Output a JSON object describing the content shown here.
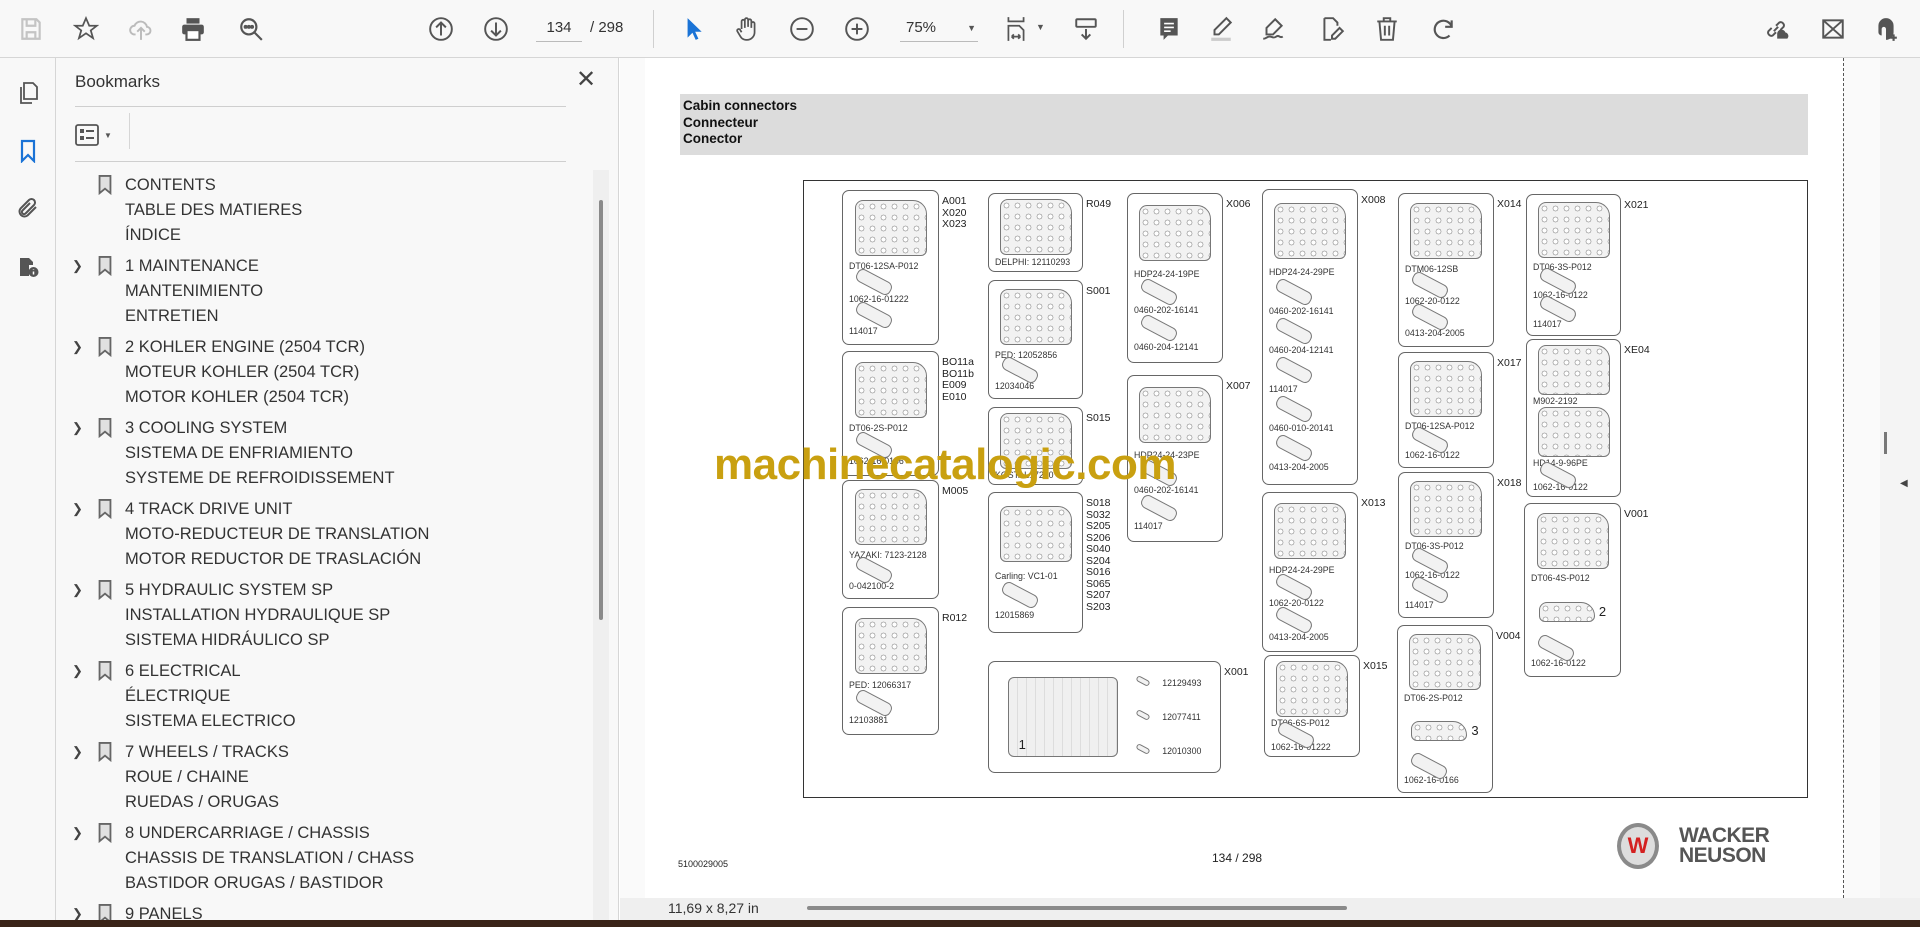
{
  "toolbar": {
    "page_current": "134",
    "page_total": "/ 298",
    "zoom": "75%",
    "accent": "#1a73d6"
  },
  "bookmarks": {
    "title": "Bookmarks",
    "close": "✕",
    "items": [
      {
        "lines": [
          "CONTENTS",
          "TABLE DES MATIERES",
          "ÍNDICE"
        ],
        "expandable": false
      },
      {
        "lines": [
          "1 MAINTENANCE",
          "MANTENIMIENTO",
          "ENTRETIEN"
        ],
        "expandable": true
      },
      {
        "lines": [
          "2 KOHLER ENGINE (2504 TCR)",
          "MOTEUR KOHLER (2504 TCR)",
          "MOTOR KOHLER (2504 TCR)"
        ],
        "expandable": true
      },
      {
        "lines": [
          "3 COOLING SYSTEM",
          "SISTEMA DE ENFRIAMIENTO",
          "SYSTEME DE REFROIDISSEMENT"
        ],
        "expandable": true
      },
      {
        "lines": [
          "4 TRACK DRIVE UNIT",
          "MOTO-REDUCTEUR DE TRANSLATION",
          "MOTOR REDUCTOR DE TRASLACIÓN"
        ],
        "expandable": true
      },
      {
        "lines": [
          "5 HYDRAULIC SYSTEM SP",
          "INSTALLATION HYDRAULIQUE SP",
          "SISTEMA HIDRÁULICO SP"
        ],
        "expandable": true
      },
      {
        "lines": [
          "6 ELECTRICAL",
          "ÉLECTRIQUE",
          "SISTEMA ELECTRICO"
        ],
        "expandable": true
      },
      {
        "lines": [
          "7 WHEELS / TRACKS",
          "ROUE / CHAINE",
          "RUEDAS / ORUGAS"
        ],
        "expandable": true
      },
      {
        "lines": [
          "8 UNDERCARRIAGE / CHASSIS",
          "CHASSIS DE TRANSLATION / CHASS",
          "BASTIDOR ORUGAS / BASTIDOR"
        ],
        "expandable": true
      },
      {
        "lines": [
          "9 PANELS"
        ],
        "expandable": true
      }
    ]
  },
  "page": {
    "header": [
      "Cabin connectors",
      "Connecteur",
      "Conector"
    ],
    "watermark": "machinecatalogic.com",
    "doc_code": "5100029005",
    "page_label": "134 / 298",
    "logo_text": [
      "WACKER",
      "NEUSON"
    ],
    "logo_mark": "W",
    "boxes": [
      {
        "ids": [
          "A001",
          "X020",
          "X023"
        ],
        "parts": [
          "DT06-12SA-P012",
          "1062-16-01222",
          "114017"
        ]
      },
      {
        "ids": [
          "BO11a",
          "BO11b",
          "E009",
          "E010"
        ],
        "parts": [
          "DT06-2S-P012",
          "1062-16-0166"
        ]
      },
      {
        "ids": [
          "M005"
        ],
        "parts": [
          "YAZAKI: 7123-2128",
          "0-042100-2"
        ]
      },
      {
        "ids": [
          "R012"
        ],
        "parts": [
          "PED: 12066317",
          "12103881"
        ]
      },
      {
        "ids": [
          "R049"
        ],
        "parts": [
          "DELPHI: 12110293"
        ]
      },
      {
        "ids": [
          "S001"
        ],
        "parts": [
          "PED: 12052856",
          "12034046"
        ]
      },
      {
        "ids": [
          "S015"
        ],
        "parts": [
          "KOSTAL: 7210"
        ]
      },
      {
        "ids": [
          "S018",
          "S032",
          "S205",
          "S206",
          "S040",
          "S204",
          "S016",
          "S065",
          "S207",
          "S203"
        ],
        "parts": [
          "Carling: VC1-01",
          "12015869"
        ]
      },
      {
        "ids": [
          "X001"
        ],
        "parts": [
          "12129493",
          "12077411",
          "12010300"
        ],
        "callout": "1"
      },
      {
        "ids": [
          "X006"
        ],
        "parts": [
          "HDP24-24-19PE",
          "0460-202-16141",
          "0460-204-12141"
        ]
      },
      {
        "ids": [
          "X007"
        ],
        "parts": [
          "HDP24-24-23PE",
          "0460-202-16141",
          "114017"
        ]
      },
      {
        "ids": [
          "X008"
        ],
        "parts": [
          "HDP24-24-29PE",
          "0460-202-16141",
          "0460-204-12141",
          "114017",
          "0460-010-20141",
          "0413-204-2005"
        ]
      },
      {
        "ids": [
          "X013"
        ],
        "parts": [
          "HDP24-24-29PE",
          "1062-20-0122",
          "0413-204-2005"
        ]
      },
      {
        "ids": [
          "X015"
        ],
        "parts": [
          "DT06-6S-P012",
          "1062-16-01222"
        ]
      },
      {
        "ids": [
          "X014"
        ],
        "parts": [
          "DTM06-12SB",
          "1062-20-0122",
          "0413-204-2005"
        ]
      },
      {
        "ids": [
          "X017"
        ],
        "parts": [
          "DT06-12SA-P012",
          "1062-16-0122"
        ]
      },
      {
        "ids": [
          "X018"
        ],
        "parts": [
          "DT06-3S-P012",
          "1062-16-0122",
          "114017"
        ]
      },
      {
        "ids": [
          "V004"
        ],
        "parts": [
          "DT06-2S-P012",
          "1062-16-0166"
        ],
        "callout": "3"
      },
      {
        "ids": [
          "X021"
        ],
        "parts": [
          "DT06-3S-P012",
          "1062-16-0122",
          "114017"
        ]
      },
      {
        "ids": [
          "XE04"
        ],
        "parts": [
          "M902-2192",
          "HD14-9-96PE",
          "1062-16-0122"
        ]
      },
      {
        "ids": [
          "V001"
        ],
        "parts": [
          "DT06-4S-P012",
          "1062-16-0122"
        ],
        "callout": "2"
      }
    ]
  },
  "status": {
    "page_size": "11,69 x 8,27 in"
  }
}
